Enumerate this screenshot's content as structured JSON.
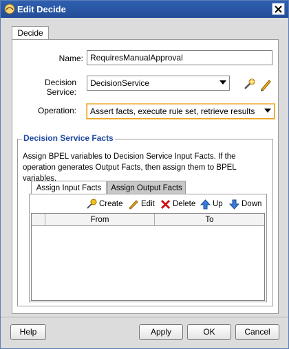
{
  "window": {
    "title": "Edit Decide"
  },
  "tabs": {
    "decide": "Decide"
  },
  "form": {
    "name_label": "Name:",
    "name_value": "RequiresManualApproval",
    "service_label": "Decision Service:",
    "service_value": "DecisionService",
    "operation_label": "Operation:",
    "operation_value": "Assert facts, execute rule set, retrieve results"
  },
  "facts": {
    "group_title": "Decision Service Facts",
    "description": "Assign BPEL variables to Decision Service Input Facts. If the operation generates Output Facts, then assign them to BPEL variables.",
    "tab_input": "Assign Input Facts",
    "tab_output": "Assign Output Facts",
    "toolbar": {
      "create": "Create",
      "edit": "Edit",
      "delete": "Delete",
      "up": "Up",
      "down": "Down"
    },
    "columns": {
      "from": "From",
      "to": "To"
    }
  },
  "buttons": {
    "help": "Help",
    "apply": "Apply",
    "ok": "OK",
    "cancel": "Cancel"
  },
  "colors": {
    "title_bar": "#2f5fb0",
    "group_title": "#1f4aa0",
    "operation_border": "#e8a020"
  }
}
